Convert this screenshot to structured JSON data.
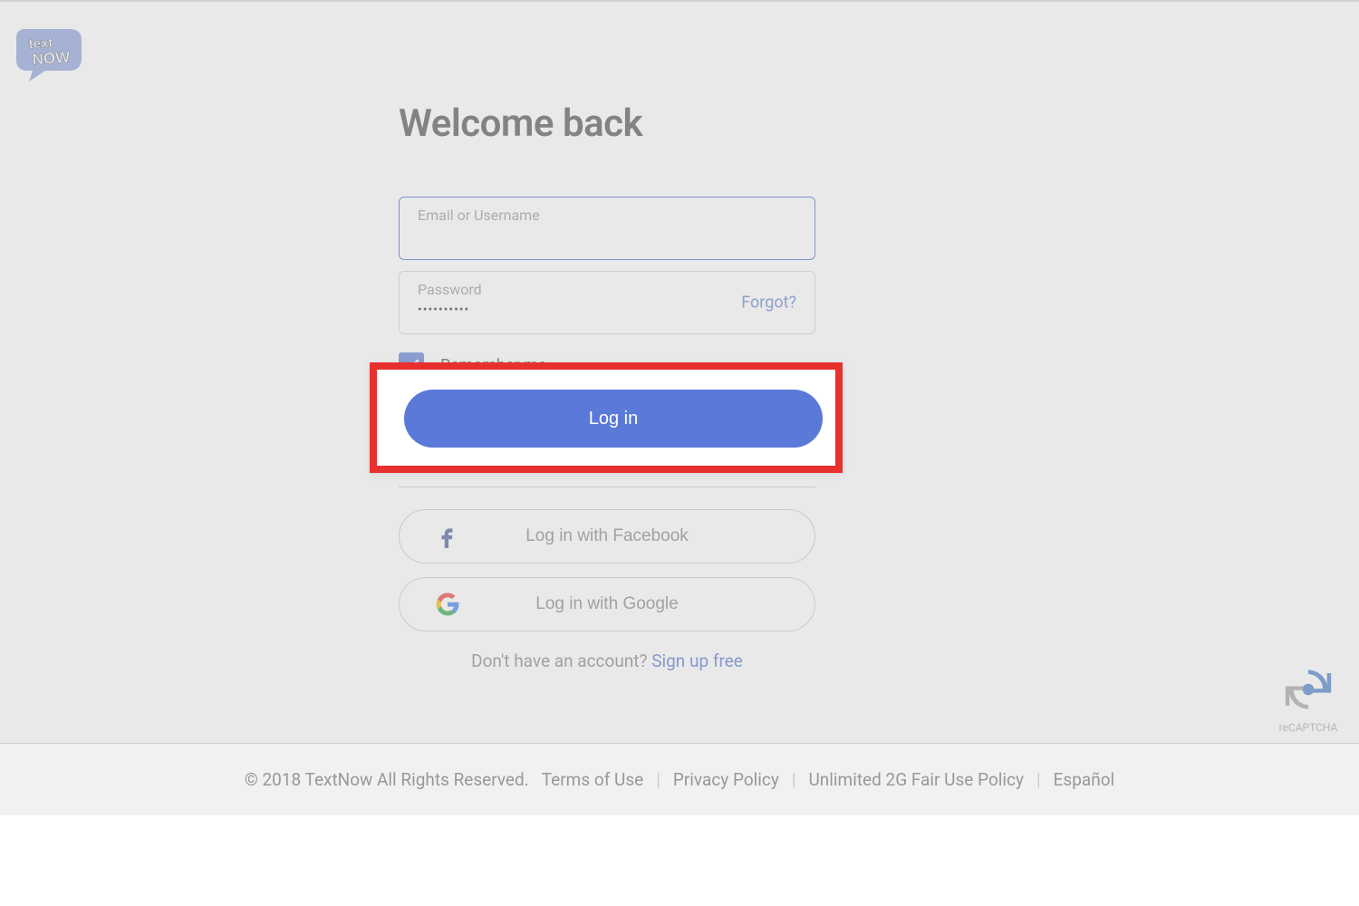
{
  "brand": {
    "logo_text_top": "text",
    "logo_text_bottom": "NOW"
  },
  "login": {
    "heading": "Welcome back",
    "email_label": "Email or Username",
    "email_value": "",
    "password_label": "Password",
    "password_value": "••••••••••",
    "forgot": "Forgot?",
    "remember": "Remember me",
    "remember_checked": true,
    "login_button": "Log in",
    "facebook_button": "Log in with Facebook",
    "google_button": "Log in with Google",
    "signup_prompt": "Don't have an account? ",
    "signup_link": "Sign up free"
  },
  "recaptcha": {
    "label": "reCAPTCHA"
  },
  "footer": {
    "copyright": "© 2018 TextNow All Rights Reserved.",
    "terms": "Terms of Use",
    "privacy": "Privacy Policy",
    "fair_use": "Unlimited 2G Fair Use Policy",
    "language": "Español"
  },
  "colors": {
    "primary": "#5a79d8",
    "highlight_border": "#e8302e"
  }
}
